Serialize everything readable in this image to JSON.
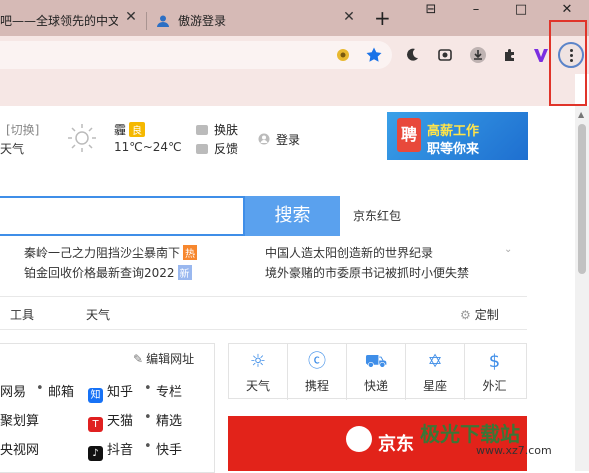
{
  "browser": {
    "tabs": [
      {
        "title": "吧——全球领先的中文"
      },
      {
        "title": "傲游登录"
      }
    ],
    "new_tab": "+",
    "window": {
      "minimize": "–",
      "maximize": "□",
      "close": "✕",
      "tab_search": "⊟"
    },
    "menu_icon": "three-dots-vertical",
    "highlight_color": "#e0342a"
  },
  "header": {
    "city": "[切换]",
    "city2": "天气",
    "condition": "霾",
    "aqi": "良",
    "temperature": "11℃~24℃",
    "skin": "换肤",
    "feedback": "反馈",
    "login": "登录",
    "ad_line1": "高薪工作",
    "ad_line2": "职等你来",
    "ad_logo": "聘"
  },
  "search": {
    "button": "搜索",
    "side_link": "京东红包"
  },
  "news": [
    {
      "text": "秦岭一己之力阻挡沙尘暴南下",
      "badge": "热"
    },
    {
      "text": "中国人造太阳创造新的世界纪录",
      "badge": ""
    },
    {
      "text": "铂金回收价格最新查询2022",
      "badge": "新"
    },
    {
      "text": "境外豪赌的市委原书记被抓时小便失禁",
      "badge": ""
    }
  ],
  "tabs_row": {
    "tools": "工具",
    "weather": "天气",
    "customize": "定制"
  },
  "sites": {
    "edit": "编辑网址",
    "rows": [
      [
        "网易",
        "邮箱",
        "知乎",
        "专栏"
      ],
      [
        "聚划算",
        "",
        "天猫",
        "精选"
      ],
      [
        "央视网",
        "",
        "抖音",
        "快手"
      ]
    ]
  },
  "tools": [
    {
      "label": "天气",
      "icon": "sun-icon"
    },
    {
      "label": "携程",
      "icon": "ctrip-icon"
    },
    {
      "label": "快递",
      "icon": "truck-icon"
    },
    {
      "label": "星座",
      "icon": "star-icon"
    },
    {
      "label": "外汇",
      "icon": "dollar-icon"
    }
  ],
  "banner": {
    "text": "京东"
  },
  "watermark": {
    "name": "极光下载站",
    "url": "www.xz7.com"
  }
}
